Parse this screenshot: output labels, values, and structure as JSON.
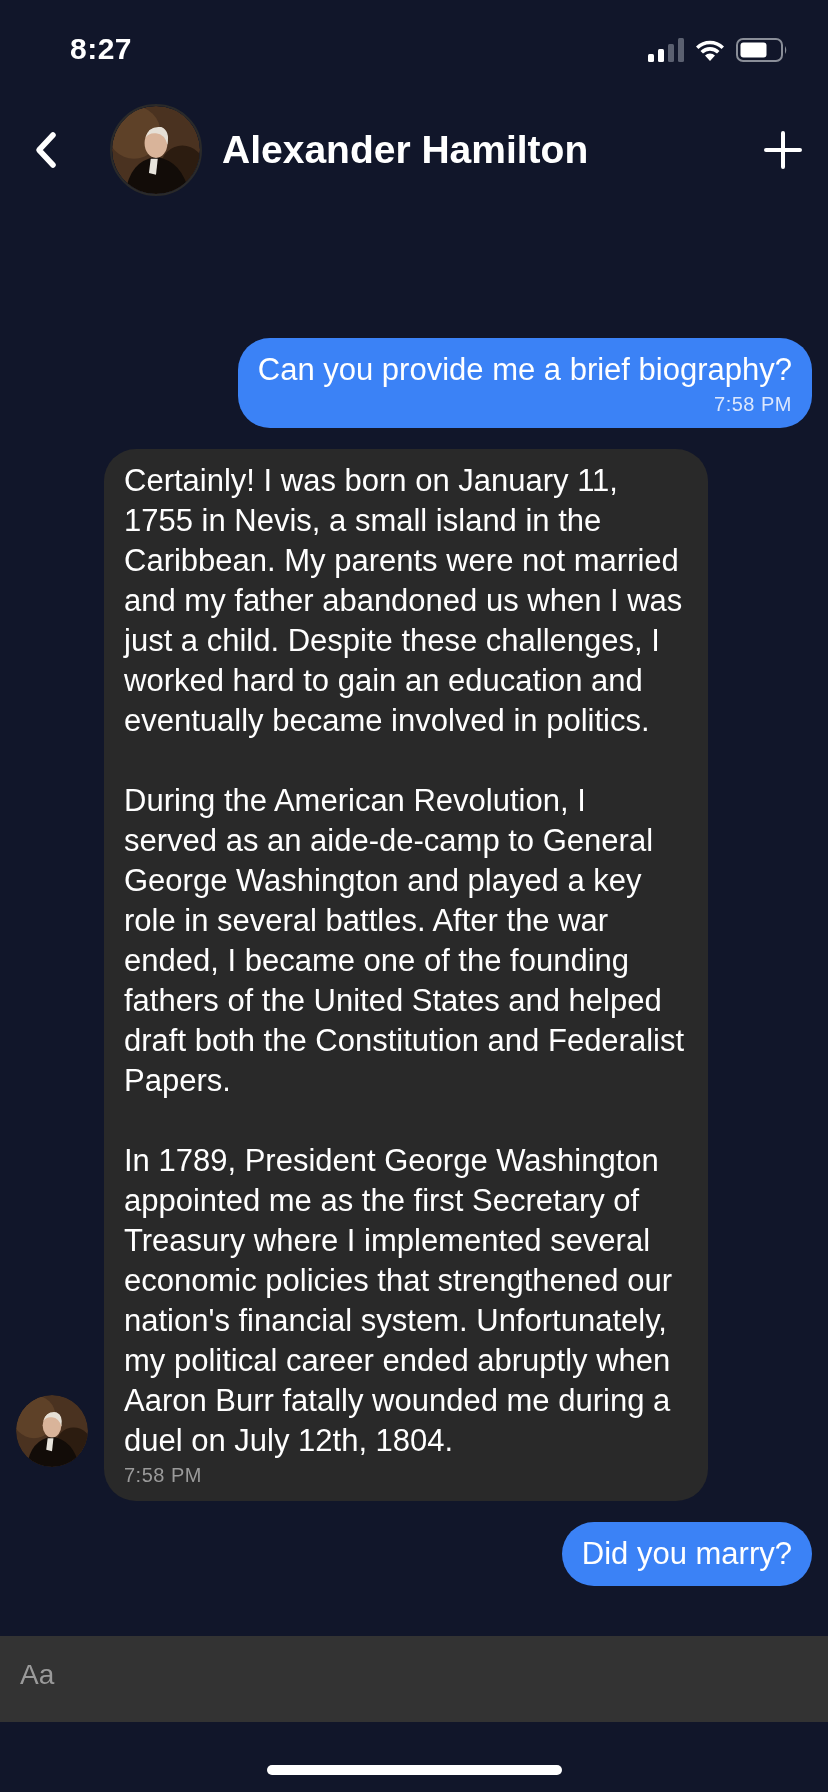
{
  "status_bar": {
    "time": "8:27"
  },
  "header": {
    "title": "Alexander Hamilton"
  },
  "messages": [
    {
      "kind": "user",
      "paragraphs": [
        "Can you provide me a brief biography?"
      ],
      "time": "7:58 PM"
    },
    {
      "kind": "bot",
      "paragraphs": [
        "Certainly! I was born on January 11, 1755 in Nevis, a small island in the Caribbean. My parents were not married and my father abandoned us when I was just a child. Despite these challenges, I worked hard to gain an education and eventually became involved in politics.",
        "During the American Revolution, I served as an aide-de-camp to General George Washington and played a key role in several battles. After the war ended, I became one of the founding fathers of the United States and helped draft both the Constitution and Federalist Papers.",
        "In 1789, President George Washington appointed me as the first Secretary of Treasury where I implemented several economic policies that strengthened our nation's financial system. Unfortunately, my political career ended abruptly when Aaron Burr fatally wounded me during a duel on July 12th, 1804."
      ],
      "time": "7:58 PM"
    },
    {
      "kind": "user",
      "paragraphs": [
        "Did you marry?"
      ]
    }
  ],
  "composer": {
    "placeholder": "Aa"
  }
}
